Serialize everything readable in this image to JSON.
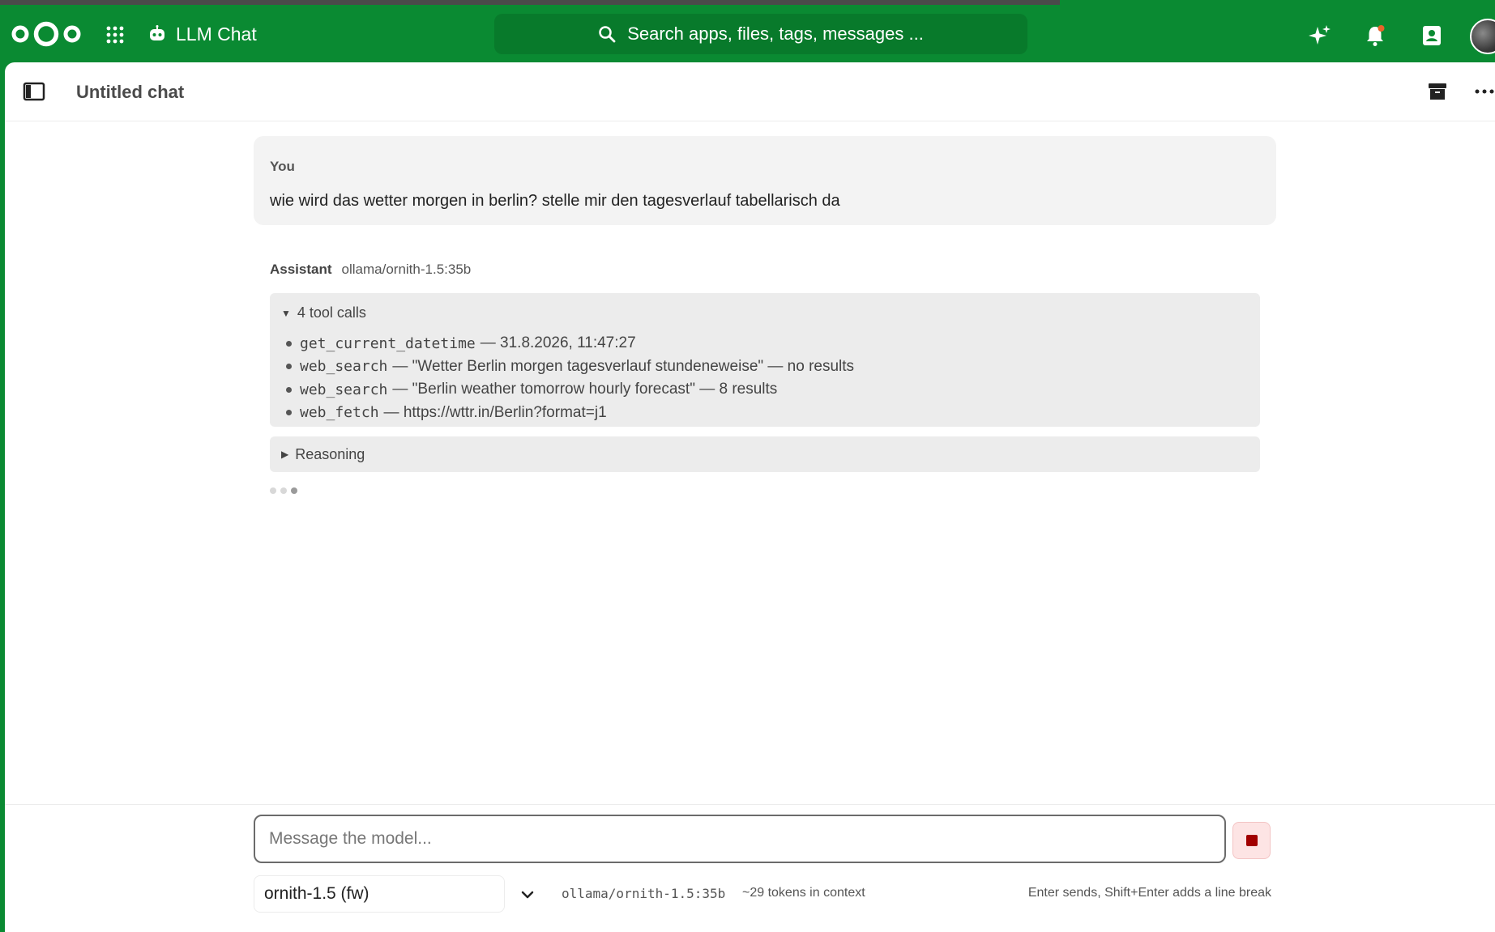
{
  "header": {
    "app_name": "LLM Chat",
    "search_placeholder": "Search apps, files, tags, messages ..."
  },
  "chat": {
    "title": "Untitled chat",
    "user_label": "You",
    "user_message": "wie wird das wetter morgen in berlin? stelle mir den tagesverlauf tabellarisch da",
    "assistant_label": "Assistant",
    "assistant_model": "ollama/ornith-1.5:35b",
    "tool_calls_summary": "4 tool calls",
    "tool_calls": [
      {
        "fn": "get_current_datetime",
        "detail": "— 31.8.2026, 11:47:27"
      },
      {
        "fn": "web_search",
        "detail": "— \"Wetter Berlin morgen tagesverlauf stundeneweise\" — no results"
      },
      {
        "fn": "web_search",
        "detail": "— \"Berlin weather tomorrow hourly forecast\" — 8 results"
      },
      {
        "fn": "web_fetch",
        "detail": "— https://wttr.in/Berlin?format=j1"
      }
    ],
    "reasoning_label": "Reasoning"
  },
  "composer": {
    "placeholder": "Message the model...",
    "model_selected": "ornith-1.5 (fw)",
    "model_id": "ollama/ornith-1.5:35b",
    "token_info": "~29 tokens in context",
    "hint": "Enter sends, Shift+Enter adds a line break"
  },
  "colors": {
    "brand": "#0a8a32",
    "stop_bg": "#fde4e4",
    "stop_icon": "#a10000"
  },
  "icons": [
    "nextcloud-logo",
    "apps-grid-icon",
    "robot-icon",
    "search-icon",
    "assistant-sparkle-icon",
    "bell-icon",
    "contacts-icon",
    "sidebar-toggle-icon",
    "archive-icon",
    "more-icon",
    "chevron-down-icon",
    "stop-icon"
  ]
}
